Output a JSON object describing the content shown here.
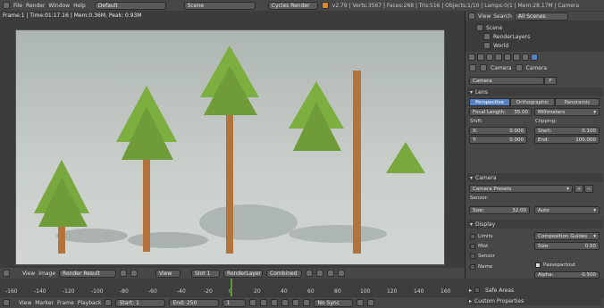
{
  "topbar": {
    "menus": [
      "File",
      "Render",
      "Window",
      "Help"
    ],
    "layout": "Default",
    "scene": "Scene",
    "engine": "Cycles Render",
    "stats": "v2.79 | Verts:3567 | Faces:268 | Tris:516 | Objects:1/10 | Lamps:0/1 | Mem:28.17M | Camera"
  },
  "viewport": {
    "info": "Frame:1 | Time:01:17.16 | Mem:0.36M, Peak: 0.93M"
  },
  "imgbar": {
    "view": "View",
    "image": "Image",
    "render_result": "Render Result",
    "view2": "View",
    "slot": "Slot 1",
    "layer": "RenderLayer",
    "pass": "Combined"
  },
  "ruler": [
    "-160",
    "-140",
    "-120",
    "-100",
    "-80",
    "-60",
    "-40",
    "-20",
    "0",
    "20",
    "40",
    "60",
    "80",
    "100",
    "120",
    "140",
    "160"
  ],
  "tlbar": {
    "view": "View",
    "marker": "Marker",
    "frame": "Frame",
    "playback": "Playback",
    "start_label": "Start:",
    "start": "1",
    "end_label": "End:",
    "end": "250",
    "cur": "1",
    "sync": "No Sync"
  },
  "outliner": {
    "view": "View",
    "search": "Search",
    "scope": "All Scenes",
    "scene": "Scene",
    "layers": "RenderLayers",
    "world": "World"
  },
  "props": {
    "breadcrumb_a": "Camera",
    "breadcrumb_b": "Camera",
    "name": "Camera",
    "f": "F",
    "lens": "Lens",
    "persp": "Perspective",
    "ortho": "Orthographic",
    "pano": "Panoramic",
    "focal_label": "Focal Length:",
    "focal": "35.00",
    "unit": "Millimeters",
    "shift": "Shift:",
    "clipping": "Clipping:",
    "x_label": "X:",
    "x": "0.000",
    "start_label": "Start:",
    "start": "0.100",
    "y_label": "Y:",
    "y": "0.000",
    "end_label": "End:",
    "end": "100.000",
    "camera": "Camera",
    "presets": "Camera Presets",
    "sensor": "Sensor:",
    "size_label": "Size:",
    "size": "32.00",
    "auto": "Auto",
    "display": "Display",
    "limits": "Limits",
    "guides": "Composition Guides",
    "mist": "Mist",
    "size2_label": "Size:",
    "size2": "0.50",
    "sensor_chk": "Sensor",
    "passepartout": "Passepartout",
    "name_chk": "Name",
    "alpha_label": "Alpha:",
    "alpha": "0.500",
    "safe": "Safe Areas",
    "custom": "Custom Properties"
  }
}
